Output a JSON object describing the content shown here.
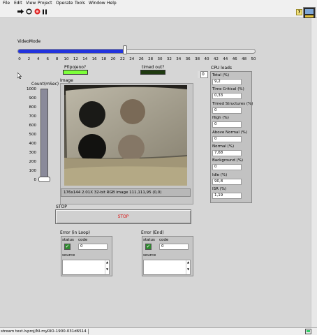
{
  "menu": [
    "File",
    "Edit",
    "View",
    "Project",
    "Operate",
    "Tools",
    "Window",
    "Help"
  ],
  "help_glyph": "?",
  "video_mode": {
    "label": "VideoMode",
    "value": 22.5,
    "min": 0,
    "max": 50,
    "ticks": [
      "0",
      "2",
      "4",
      "6",
      "8",
      "10",
      "12",
      "14",
      "16",
      "18",
      "20",
      "22",
      "24",
      "26",
      "28",
      "30",
      "32",
      "34",
      "36",
      "38",
      "40",
      "42",
      "44",
      "46",
      "48",
      "50"
    ],
    "fill_color": "#2233dd"
  },
  "booleans": {
    "ppojeno": {
      "label": "Připojeno?",
      "color": "#7dff3a"
    },
    "timed_out": {
      "label": "timed out?",
      "color": "#1f3a10"
    }
  },
  "count": {
    "label": "Count(mSec)",
    "ticks": [
      "1000",
      "900",
      "800",
      "700",
      "600",
      "500",
      "400",
      "300",
      "200",
      "100",
      "0"
    ],
    "value": 0
  },
  "image": {
    "label": "Image",
    "info": "176x144 2.01X 32-bit RGB image 111,111,95     (0,0)"
  },
  "cpu_loads": {
    "label": "CPU loads",
    "index": "0",
    "items": [
      {
        "name": "Total (%)",
        "value": "9,2"
      },
      {
        "name": "Time Critical (%)",
        "value": "0,33"
      },
      {
        "name": "Timed Structures (%)",
        "value": "0"
      },
      {
        "name": "High (%)",
        "value": "0"
      },
      {
        "name": "Above Normal (%)",
        "value": "0"
      },
      {
        "name": "Normal (%)",
        "value": "7,68"
      },
      {
        "name": "Background (%)",
        "value": "0"
      },
      {
        "name": "Idle (%)",
        "value": "90,8"
      },
      {
        "name": "ISR (%)",
        "value": "1,19"
      }
    ]
  },
  "stop": {
    "label": "STOP",
    "button_text": "STOP"
  },
  "errors": [
    {
      "title": "Error (in Loop)",
      "status_label": "status",
      "code_label": "code",
      "code_value": "0",
      "source_label": "source"
    },
    {
      "title": "Error (End)",
      "status_label": "status",
      "code_label": "code",
      "code_value": "0",
      "source_label": "source"
    }
  ],
  "status_bar": {
    "text": "stream test.lvproj/NI-myRIO-1900-031d6514"
  }
}
